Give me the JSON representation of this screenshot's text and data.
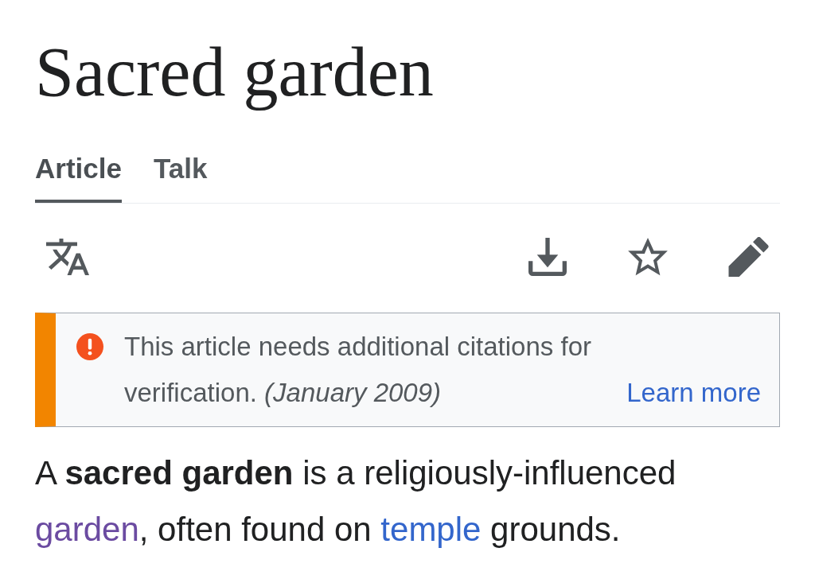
{
  "page": {
    "title": "Sacred garden"
  },
  "tabs": [
    {
      "label": "Article",
      "selected": true
    },
    {
      "label": "Talk",
      "selected": false
    }
  ],
  "notice": {
    "message": "This article needs additional citations for verification. *(January 2009)*",
    "link": "Learn more"
  },
  "intro": {
    "parts": [
      {
        "kind": "text",
        "text": "A **sacred garden** is a religiously-influenced "
      },
      {
        "kind": "link",
        "text": "garden",
        "visited": true
      },
      {
        "kind": "text",
        "text": ", often found on "
      },
      {
        "kind": "link",
        "text": "temple",
        "visited": false
      },
      {
        "kind": "text",
        "text": " grounds."
      }
    ]
  }
}
